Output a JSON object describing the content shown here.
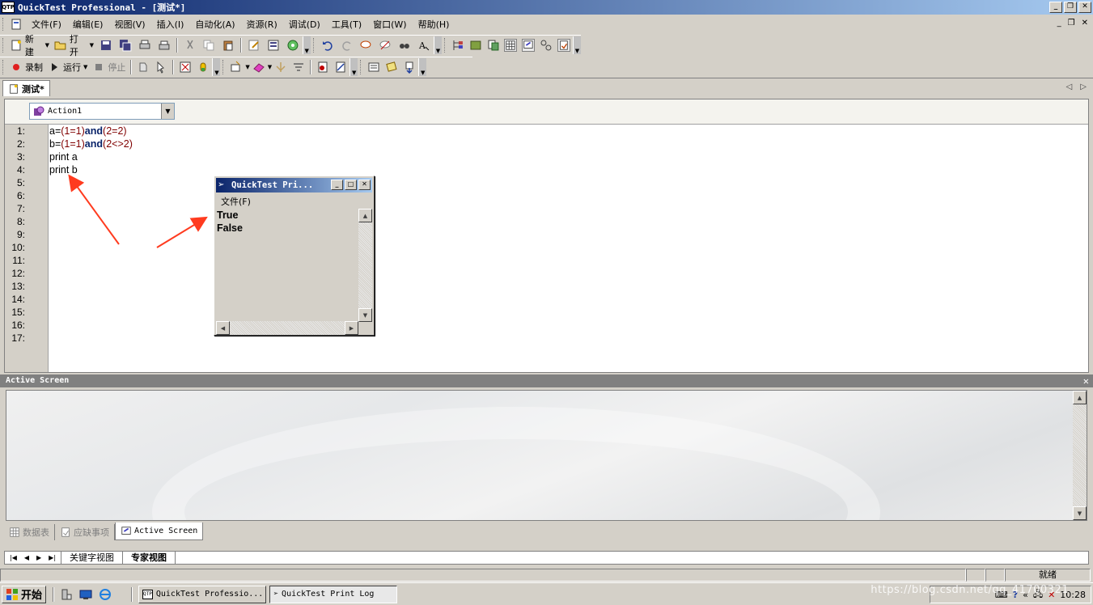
{
  "window": {
    "title": "QuickTest Professional - [测试*]",
    "app_icon_text": "QTP"
  },
  "menu": [
    "文件(F)",
    "编辑(E)",
    "视图(V)",
    "插入(I)",
    "自动化(A)",
    "资源(R)",
    "调试(D)",
    "工具(T)",
    "窗口(W)",
    "帮助(H)"
  ],
  "toolbar1": {
    "new_label": "新建",
    "open_label": "打开"
  },
  "toolbar2": {
    "record_label": "录制",
    "run_label": "运行",
    "stop_label": "停止"
  },
  "doc_tab": {
    "label": "测试*"
  },
  "action_select": {
    "value": "Action1"
  },
  "editor": {
    "line_numbers": [
      "1:",
      "2:",
      "3:",
      "4:",
      "5:",
      "6:",
      "7:",
      "8:",
      "9:",
      "10:",
      "11:",
      "12:",
      "13:",
      "14:",
      "15:",
      "16:",
      "17:"
    ],
    "lines": [
      {
        "a": "a=",
        "b": "(1=1)",
        "kw": "and",
        "c": "(2=2)"
      },
      {
        "a": "b=",
        "b": "(1=1)",
        "kw": "and",
        "c": "(2<>2)"
      },
      {
        "plain": "print a"
      },
      {
        "plain": "print b"
      }
    ]
  },
  "print_log": {
    "title": "QuickTest Pri...",
    "menu_file": "文件(F)",
    "output": [
      "True",
      "False"
    ]
  },
  "active_screen": {
    "title": "Active Screen"
  },
  "pane_tabs": {
    "data_table": "数据表",
    "missing_resources": "应缺事项",
    "active_screen": "Active Screen"
  },
  "view_tabs": {
    "keyword": "关键字视图",
    "expert": "专家视图"
  },
  "status": {
    "ready": "就绪"
  },
  "taskbar": {
    "start": "开始",
    "task1": "QuickTest Professio...",
    "task2": "QuickTest Print Log",
    "clock": "10:28"
  },
  "watermark": "https://blog.csdn.net/qq_41700321",
  "colors": {
    "title_start": "#0a246a",
    "title_end": "#a6caf0",
    "keyword": "#0a246a",
    "operator": "#800000",
    "arrow": "#ff3b1f"
  }
}
